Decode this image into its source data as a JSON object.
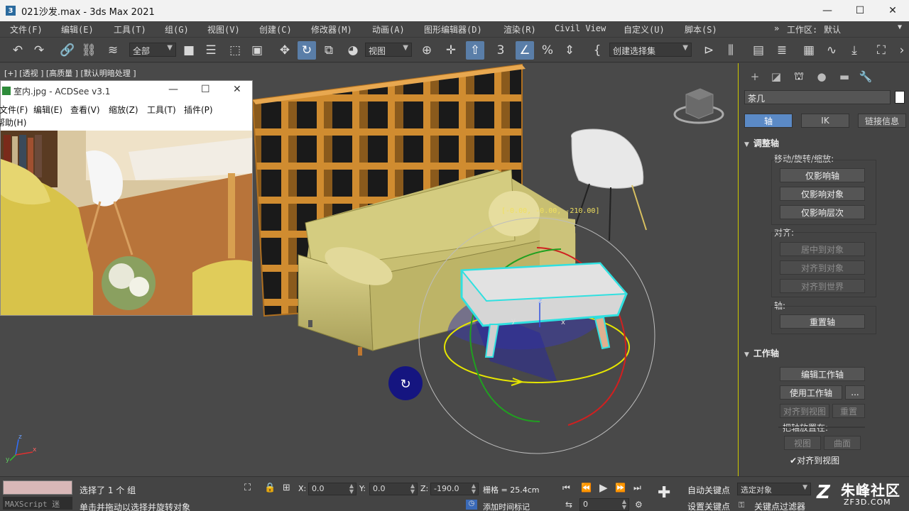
{
  "window": {
    "title": "021沙发.max - 3ds Max 2021",
    "minimize": "—",
    "maximize": "☐",
    "close": "✕"
  },
  "menu": {
    "items": [
      "文件(F)",
      "编辑(E)",
      "工具(T)",
      "组(G)",
      "视图(V)",
      "创建(C)",
      "修改器(M)",
      "动画(A)",
      "图形编辑器(D)",
      "渲染(R)",
      "Civil View",
      "自定义(U)",
      "脚本(S)"
    ],
    "workspace_label": "工作区:",
    "workspace_value": "默认"
  },
  "toolbar": {
    "selection_filter": "全部",
    "ref_coord": "视图",
    "named_selection": "创建选择集"
  },
  "viewport": {
    "label": "[+] [透视 ] [高质量 ] [默认明暗处理 ]",
    "gizmo_readout": "[-0.00, -0.00, -210.00]",
    "axis_z": "z",
    "axis_x": "x",
    "axis_y": "y"
  },
  "acdsee": {
    "title": "室内.jpg - ACDSee v3.1",
    "menu": [
      "文件(F)",
      "编辑(E)",
      "查看(V)",
      "缩放(Z)",
      "工具(T)",
      "插件(P)"
    ],
    "menu_help": "帮助(H)"
  },
  "command_panel": {
    "object_name": "茶几",
    "tabs": [
      "轴",
      "IK",
      "链接信息"
    ],
    "rollout_adjust_pivot": "调整轴",
    "move_rotate_scale_label": "移动/旋转/缩放:",
    "btn_affect_pivot_only": "仅影响轴",
    "btn_affect_object_only": "仅影响对象",
    "btn_affect_hierarchy_only": "仅影响层次",
    "align_label": "对齐:",
    "btn_center_to_object": "居中到对象",
    "btn_align_to_object": "对齐到对象",
    "btn_align_to_world": "对齐到世界",
    "pivot_label": "轴:",
    "btn_reset_pivot": "重置轴",
    "rollout_working_pivot": "工作轴",
    "btn_edit_working_pivot": "编辑工作轴",
    "btn_use_working_pivot": "使用工作轴",
    "btn_more": "...",
    "btn_align_to_view": "对齐到视图",
    "btn_reset": "重置",
    "place_pivot_label": "把轴放置在:",
    "btn_view": "视图",
    "btn_surface": "曲面",
    "chk_align_to_view": "对齐到视图"
  },
  "status": {
    "maxscript_label": "MAXScript 迷",
    "selection_info": "选择了 1 个 组",
    "prompt": "单击并拖动以选择并旋转对象",
    "x_label": "X:",
    "x_value": "0.0",
    "y_label": "Y:",
    "y_value": "0.0",
    "z_label": "Z:",
    "z_value": "-190.0",
    "grid": "栅格 = 25.4cm",
    "add_time_tag": "添加时间标记",
    "auto_key": "自动关键点",
    "selected_object": "选定对象",
    "set_key": "设置关键点",
    "key_filters": "关键点过滤器",
    "frame": "0"
  },
  "watermark": {
    "text": "朱峰社区",
    "url": "ZF3D.COM"
  }
}
